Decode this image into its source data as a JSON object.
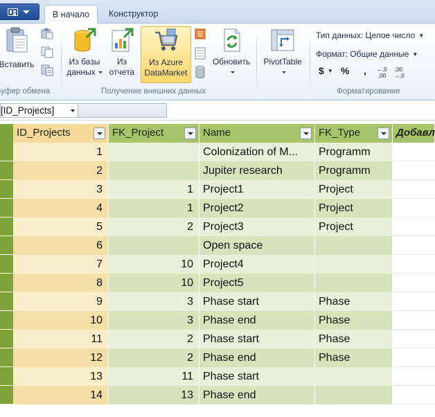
{
  "tabs": {
    "home": "В начало",
    "designer": "Конструктор"
  },
  "clipboard": {
    "paste_label": "Вставить",
    "group_label": "Буфер обмена"
  },
  "external": {
    "from_db_line1": "Из базы",
    "from_db_line2": "данных",
    "from_report_line1": "Из",
    "from_report_line2": "отчета",
    "from_azure_line1": "Из Azure",
    "from_azure_line2": "DataMarket",
    "refresh_label": "Обновить",
    "group_label": "Получение внешних данных"
  },
  "pivot": {
    "label": "PivotTable"
  },
  "formatting": {
    "data_type": "Тип данных: Целое число",
    "format": "Формат: Общие данные",
    "currency": "$",
    "percent": "%",
    "comma": ",",
    "inc_decimal": "←,0 ,00",
    "dec_decimal": ",00 →,0",
    "group_label": "Форматирование"
  },
  "formula_bar": {
    "name_box": "[ID_Projects]"
  },
  "table": {
    "columns": [
      "ID_Projects",
      "FK_Project",
      "Name",
      "FK_Type"
    ],
    "add_column": "Добавл",
    "rows": [
      {
        "id": "1",
        "fk_project": "",
        "name": "Colonization of M...",
        "fk_type": "Programm"
      },
      {
        "id": "2",
        "fk_project": "",
        "name": "Jupiter research",
        "fk_type": "Programm"
      },
      {
        "id": "3",
        "fk_project": "1",
        "name": "Project1",
        "fk_type": "Project"
      },
      {
        "id": "4",
        "fk_project": "1",
        "name": "Project2",
        "fk_type": "Project"
      },
      {
        "id": "5",
        "fk_project": "2",
        "name": "Project3",
        "fk_type": "Project"
      },
      {
        "id": "6",
        "fk_project": "",
        "name": "Open space",
        "fk_type": ""
      },
      {
        "id": "7",
        "fk_project": "10",
        "name": "Project4",
        "fk_type": ""
      },
      {
        "id": "8",
        "fk_project": "10",
        "name": "Project5",
        "fk_type": ""
      },
      {
        "id": "9",
        "fk_project": "3",
        "name": "Phase start",
        "fk_type": "Phase"
      },
      {
        "id": "10",
        "fk_project": "3",
        "name": "Phase end",
        "fk_type": "Phase"
      },
      {
        "id": "11",
        "fk_project": "2",
        "name": "Phase start",
        "fk_type": "Phase"
      },
      {
        "id": "12",
        "fk_project": "2",
        "name": "Phase end",
        "fk_type": "Phase"
      },
      {
        "id": "13",
        "fk_project": "11",
        "name": "Phase start",
        "fk_type": ""
      },
      {
        "id": "14",
        "fk_project": "13",
        "name": "Phase end",
        "fk_type": ""
      }
    ]
  },
  "colors": {
    "header_green": "#a8c46a",
    "row_band_dark": "#d5e4bb",
    "row_band_light": "#e8f0da",
    "selected_column": "#f4d99b",
    "row_selector": "#7ea33b"
  }
}
